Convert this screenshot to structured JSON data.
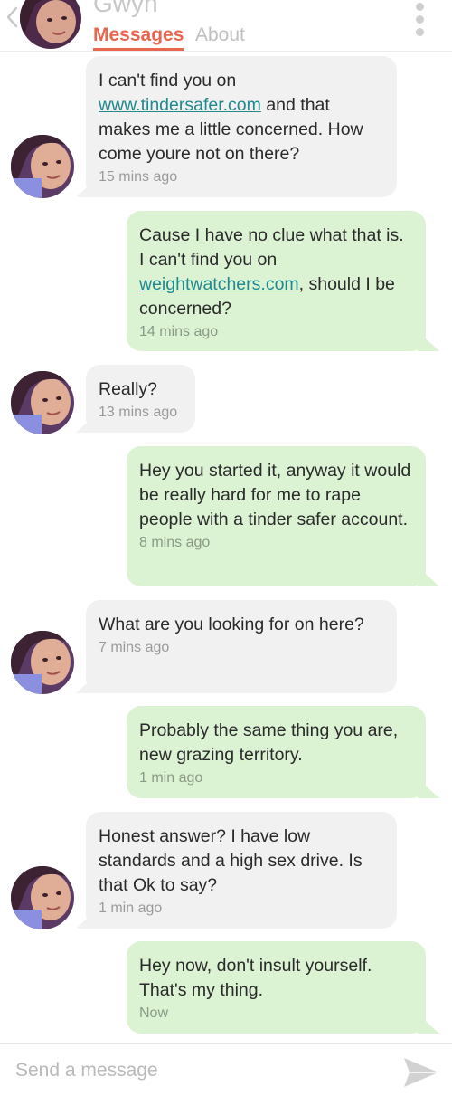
{
  "header": {
    "match_name": "Gwyn",
    "tabs": [
      "Messages",
      "About"
    ],
    "active_tab": "Messages"
  },
  "messages": [
    {
      "side": "in",
      "lines": [
        "I can't find you on"
      ],
      "link": "www.tindersafer.com",
      "after_link": " and that makes me a little concerned. How come youre not on there?",
      "time": "15 mins ago"
    },
    {
      "side": "out",
      "before_link": "Cause I have no clue what that is. I can't find you on ",
      "link": "weightwatchers.com",
      "after_link": ", should I be concerned?",
      "time": "14 mins ago"
    },
    {
      "side": "in",
      "text": "Really?",
      "time": "13 mins ago"
    },
    {
      "side": "out",
      "text": "Hey you started it, anyway it would be really hard for me to rape people with a tinder safer account.",
      "time": "8 mins ago"
    },
    {
      "side": "in",
      "text": "What are you looking for on here?",
      "time": "7 mins ago"
    },
    {
      "side": "out",
      "text": "Probably the same thing you are, new grazing territory.",
      "time": "1 min ago"
    },
    {
      "side": "in",
      "text": "Honest answer? I have low standards and a high sex drive. Is that Ok to say?",
      "time": "1 min ago"
    },
    {
      "side": "out",
      "text": "Hey now, don't insult yourself. That's my thing.",
      "time": "Now"
    }
  ],
  "composer": {
    "placeholder": "Send a message"
  },
  "colors": {
    "accent": "#e8664d",
    "incoming_bubble": "#f1f1f1",
    "outgoing_bubble": "#dbf2d3",
    "link": "#1f8a8f"
  },
  "icons": [
    "back-chevron-icon",
    "kebab-menu-icon",
    "send-icon"
  ]
}
